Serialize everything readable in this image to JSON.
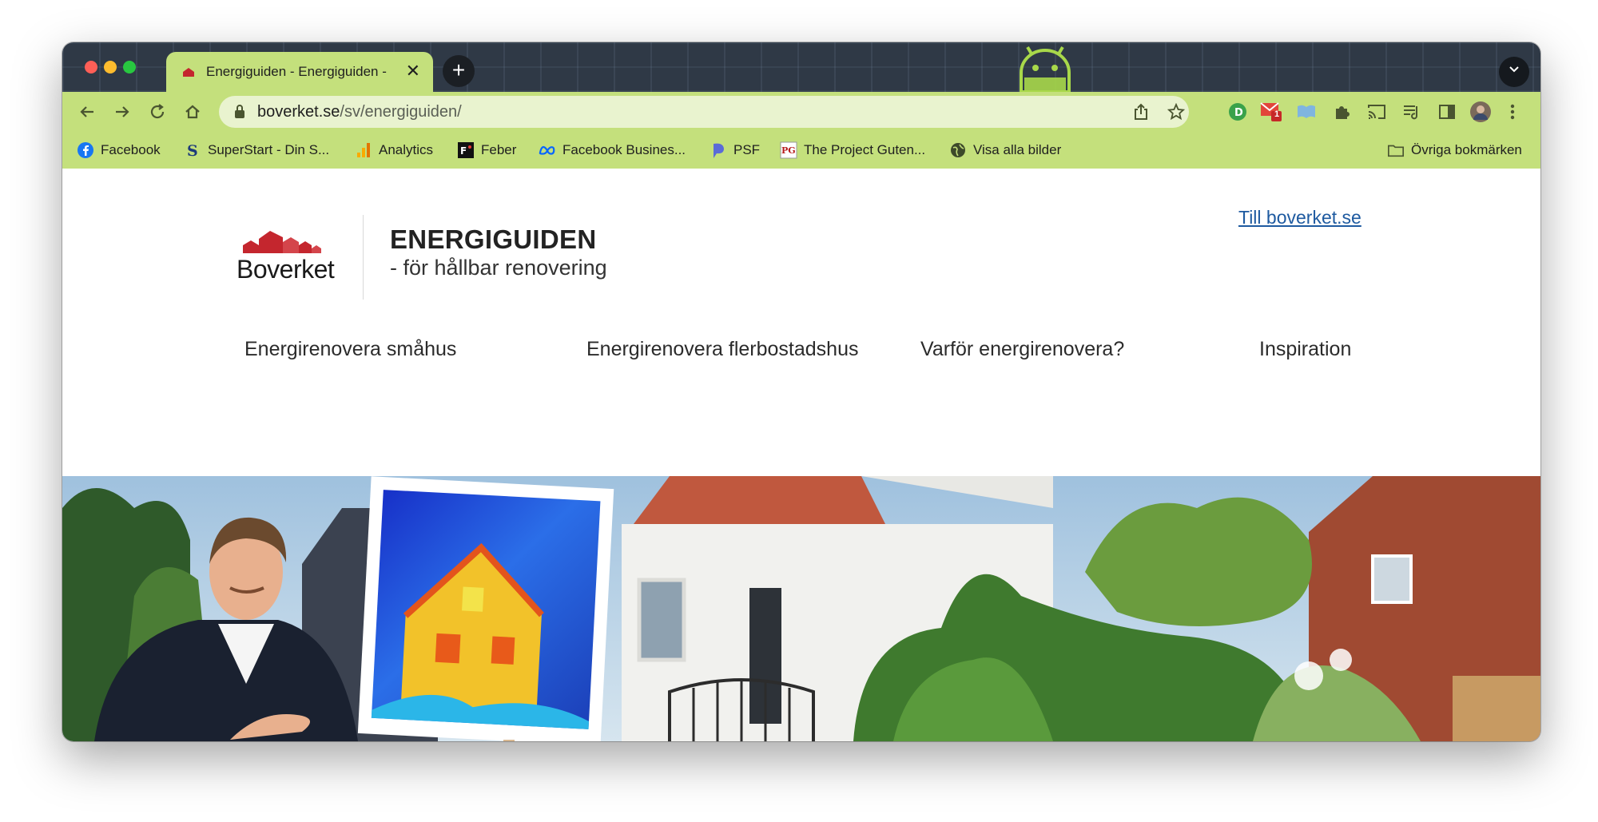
{
  "browser": {
    "tab": {
      "title": "Energiguiden - Energiguiden - ",
      "close": "✕"
    },
    "new_tab": "+",
    "tab_menu": "⌄",
    "address": {
      "domain": "boverket.se",
      "path": "/sv/energiguiden/"
    },
    "extensions": {
      "gmail_badge": "1"
    },
    "bookmarks": [
      {
        "label": "Facebook",
        "icon": "facebook-icon"
      },
      {
        "label": "SuperStart - Din S...",
        "icon": "superstart-icon"
      },
      {
        "label": "Analytics",
        "icon": "analytics-icon"
      },
      {
        "label": "Feber",
        "icon": "feber-icon"
      },
      {
        "label": "Facebook Busines...",
        "icon": "meta-icon"
      },
      {
        "label": "PSF",
        "icon": "psf-icon"
      },
      {
        "label": "The Project Guten...",
        "icon": "gutenberg-icon"
      },
      {
        "label": "Visa alla bilder",
        "icon": "globe-icon"
      }
    ],
    "other_bookmarks": "Övriga bokmärken"
  },
  "page": {
    "logo_text": "Boverket",
    "site_title": "ENERGIGUIDEN",
    "site_subtitle": "- för hållbar renovering",
    "top_link": "Till boverket.se",
    "menu": [
      "Energirenovera småhus",
      "Energirenovera flerbostadshus",
      "Varför energirenovera?",
      "Inspiration"
    ]
  },
  "colors": {
    "theme_green": "#c4e07c",
    "link_blue": "#1e5aa0",
    "logo_red": "#c4262e"
  }
}
